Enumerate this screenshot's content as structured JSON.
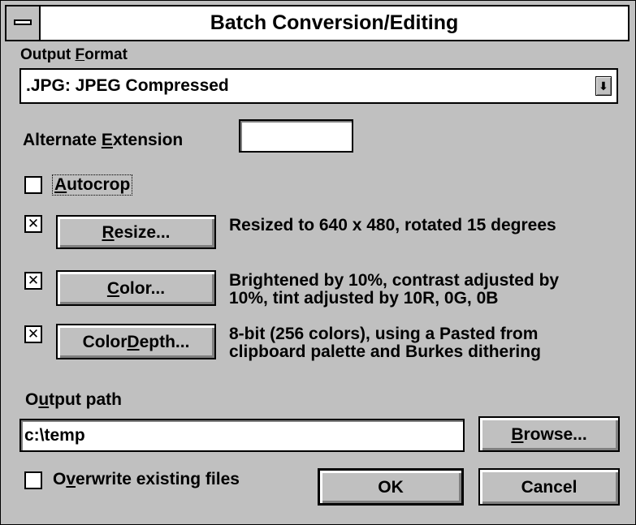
{
  "window": {
    "title": "Batch Conversion/Editing"
  },
  "output_format": {
    "label_pre": "Output ",
    "label_u": "F",
    "label_post": "ormat",
    "value": ".JPG: JPEG Compressed"
  },
  "alt_ext": {
    "label_pre": "Alternate ",
    "label_u": "E",
    "label_post": "xtension",
    "value": ""
  },
  "autocrop": {
    "label_u": "A",
    "label_post": "utocrop",
    "checked_mark": ""
  },
  "resize": {
    "checked_mark": "✕",
    "button_u": "R",
    "button_post": "esize...",
    "desc": "Resized to 640 x 480, rotated 15 degrees"
  },
  "color": {
    "checked_mark": "✕",
    "button_u": "C",
    "button_post": "olor...",
    "desc_line1": "Brightened by 10%, contrast adjusted by",
    "desc_line2": "10%, tint adjusted by 10R, 0G, 0B"
  },
  "depth": {
    "checked_mark": "✕",
    "button_pre": "Color ",
    "button_u": "D",
    "button_post": "epth...",
    "desc_line1": "8-bit (256 colors), using a Pasted from",
    "desc_line2": "clipboard palette and Burkes dithering"
  },
  "output_path": {
    "label_pre": "O",
    "label_u": "u",
    "label_post": "tput path",
    "value": "c:\\temp",
    "browse_u": "B",
    "browse_post": "rowse..."
  },
  "overwrite": {
    "checked_mark": "",
    "label_pre": "O",
    "label_u": "v",
    "label_post": "erwrite existing files"
  },
  "buttons": {
    "ok": "OK",
    "cancel": "Cancel"
  }
}
